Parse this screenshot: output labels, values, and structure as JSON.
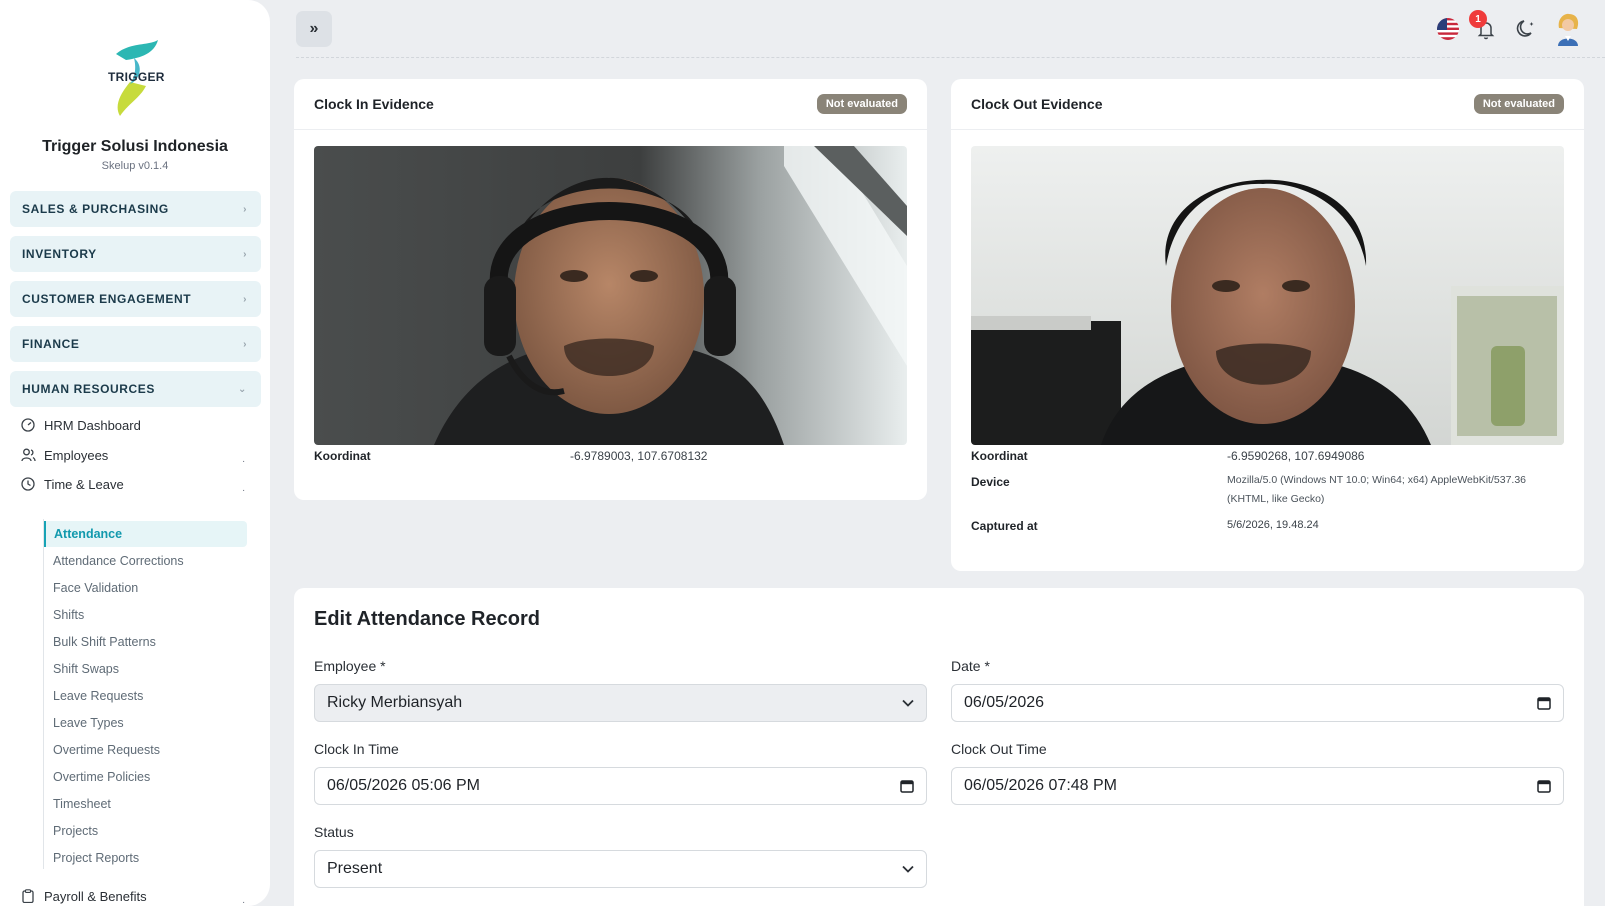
{
  "brand": {
    "logo_text": "TRIGGER",
    "company": "Trigger Solusi Indonesia",
    "version": "Skelup v0.1.4"
  },
  "sidebar": {
    "sections": [
      {
        "label": "SALES & PURCHASING"
      },
      {
        "label": "INVENTORY"
      },
      {
        "label": "CUSTOMER ENGAGEMENT"
      },
      {
        "label": "FINANCE"
      },
      {
        "label": "HUMAN RESOURCES"
      }
    ],
    "items": [
      {
        "label": "HRM Dashboard",
        "icon": "gauge-icon"
      },
      {
        "label": "Employees",
        "icon": "users-icon"
      },
      {
        "label": "Time & Leave",
        "icon": "clock-icon"
      },
      {
        "label": "Payroll & Benefits",
        "icon": "clipboard-icon"
      }
    ],
    "sub_items": [
      {
        "label": "Attendance"
      },
      {
        "label": "Attendance Corrections"
      },
      {
        "label": "Face Validation"
      },
      {
        "label": "Shifts"
      },
      {
        "label": "Bulk Shift Patterns"
      },
      {
        "label": "Shift Swaps"
      },
      {
        "label": "Leave Requests"
      },
      {
        "label": "Leave Types"
      },
      {
        "label": "Overtime Requests"
      },
      {
        "label": "Overtime Policies"
      },
      {
        "label": "Timesheet"
      },
      {
        "label": "Projects"
      },
      {
        "label": "Project Reports"
      }
    ],
    "accent": "#16a3b5"
  },
  "topbar": {
    "notification_count": "1"
  },
  "clock_in": {
    "title": "Clock In Evidence",
    "status": "Not evaluated",
    "coord_label": "Koordinat",
    "coord_value": "-6.9789003, 107.6708132"
  },
  "clock_out": {
    "title": "Clock Out Evidence",
    "status": "Not evaluated",
    "coord_label": "Koordinat",
    "coord_value": "-6.9590268, 107.6949086",
    "device_label": "Device",
    "device_value": "Mozilla/5.0 (Windows NT 10.0; Win64; x64) AppleWebKit/537.36 (KHTML, like Gecko)",
    "captured_label": "Captured at",
    "captured_value": "5/6/2026, 19.48.24"
  },
  "form": {
    "title": "Edit Attendance Record",
    "employee_label": "Employee *",
    "employee_value": "Ricky Merbiansyah",
    "date_label": "Date *",
    "date_value": "06/05/2026",
    "clock_in_label": "Clock In Time",
    "clock_in_value": "06/05/2026 05:06  PM",
    "clock_out_label": "Clock Out Time",
    "clock_out_value": "06/05/2026 07:48  PM",
    "status_label": "Status",
    "status_value": "Present"
  }
}
